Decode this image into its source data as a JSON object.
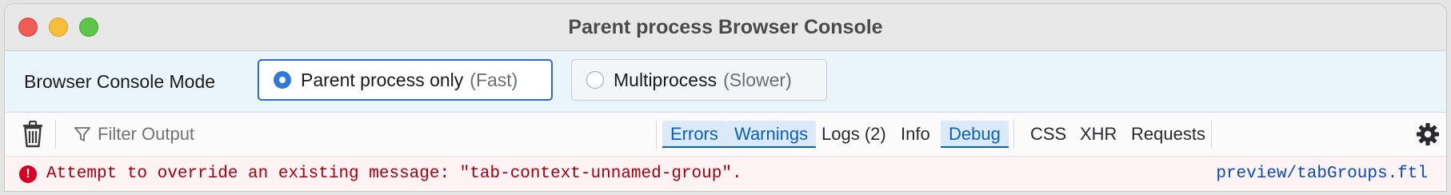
{
  "window": {
    "title": "Parent process Browser Console",
    "controls": [
      "close",
      "minimize",
      "maximize"
    ]
  },
  "mode_bar": {
    "label": "Browser Console Mode",
    "options": [
      {
        "label": "Parent process only",
        "hint": "(Fast)",
        "selected": true
      },
      {
        "label": "Multiprocess",
        "hint": "(Slower)",
        "selected": false
      }
    ]
  },
  "toolbar": {
    "clear_icon": "trash-icon",
    "filter_placeholder": "Filter Output",
    "filter_value": "",
    "filters": [
      {
        "label": "Errors",
        "checked": true
      },
      {
        "label": "Warnings",
        "checked": true
      },
      {
        "label": "Logs (2)",
        "checked": false
      },
      {
        "label": "Info",
        "checked": false
      },
      {
        "label": "Debug",
        "checked": true
      },
      {
        "label": "CSS",
        "checked": false
      },
      {
        "label": "XHR",
        "checked": false
      },
      {
        "label": "Requests",
        "checked": false
      }
    ],
    "settings_icon": "gear-icon"
  },
  "messages": [
    {
      "level": "error",
      "text": "Attempt to override an existing message: \"tab-context-unnamed-group\".",
      "source": "preview/tabGroups.ftl"
    }
  ],
  "colors": {
    "accent": "#0a60c2",
    "error_text": "#a4000f",
    "error_bg": "#fdf2f4",
    "mode_bar_bg": "#eaf4fb"
  }
}
